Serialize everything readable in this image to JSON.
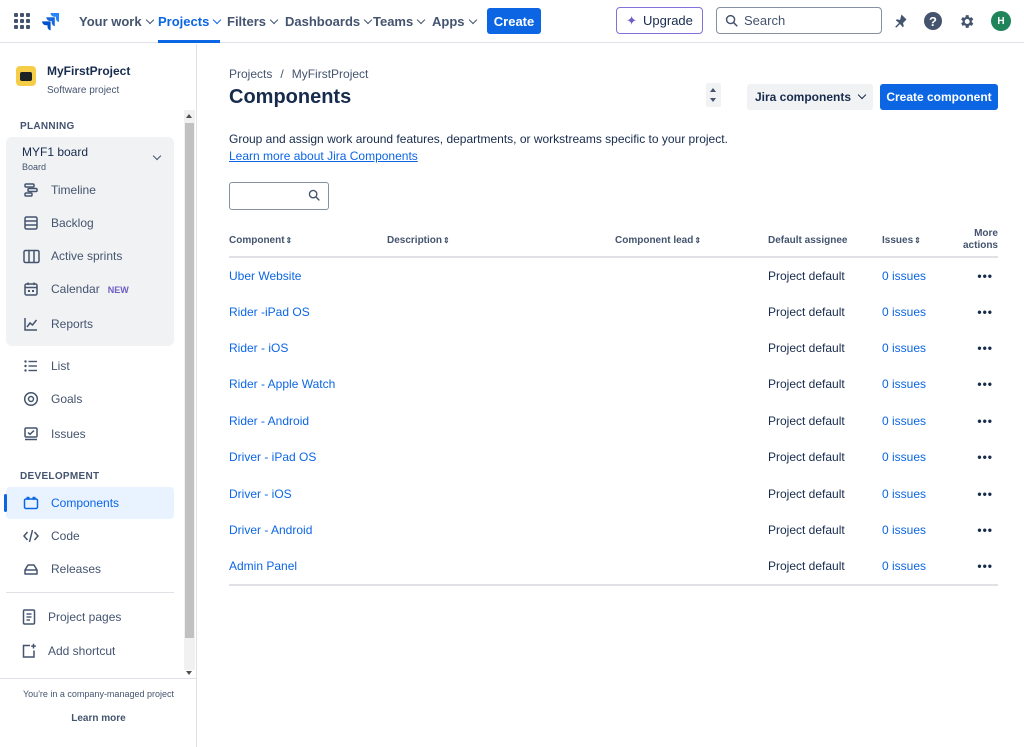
{
  "topnav": {
    "your_work": "Your work",
    "projects": "Projects",
    "filters": "Filters",
    "dashboards": "Dashboards",
    "teams": "Teams",
    "apps": "Apps",
    "create": "Create",
    "upgrade": "Upgrade",
    "search_placeholder": "Search",
    "avatar_initial": "H",
    "help_glyph": "?"
  },
  "project": {
    "name": "MyFirstProject",
    "type": "Software project"
  },
  "sidebar": {
    "planning_label": "PLANNING",
    "board": {
      "title": "MYF1 board",
      "subtitle": "Board"
    },
    "board_items": [
      {
        "label": "Timeline",
        "icon": "timeline-icon"
      },
      {
        "label": "Backlog",
        "icon": "backlog-icon"
      },
      {
        "label": "Active sprints",
        "icon": "board-icon"
      },
      {
        "label": "Calendar",
        "icon": "calendar-icon",
        "badge": "NEW"
      },
      {
        "label": "Reports",
        "icon": "reports-icon"
      }
    ],
    "items": [
      {
        "label": "List",
        "icon": "list-icon"
      },
      {
        "label": "Goals",
        "icon": "goals-icon"
      },
      {
        "label": "Issues",
        "icon": "issues-icon"
      }
    ],
    "development_label": "DEVELOPMENT",
    "dev_items": [
      {
        "label": "Components",
        "icon": "components-icon",
        "active": true
      },
      {
        "label": "Code",
        "icon": "code-icon"
      },
      {
        "label": "Releases",
        "icon": "releases-icon"
      }
    ],
    "bottom_items": [
      {
        "label": "Project pages",
        "icon": "project-pages-icon"
      },
      {
        "label": "Add shortcut",
        "icon": "add-shortcut-icon"
      }
    ],
    "footer_note": "You're in a company-managed project",
    "footer_link": "Learn more"
  },
  "main": {
    "breadcrumb": [
      "Projects",
      "MyFirstProject"
    ],
    "breadcrumb_separator": "/",
    "title": "Components",
    "jira_components_button": "Jira components",
    "create_component_button": "Create component",
    "description": "Group and assign work around features, departments, or workstreams specific to your project.",
    "learn_more": "Learn more about Jira Components",
    "filter_value": ""
  },
  "table": {
    "headers": {
      "component": "Component",
      "description": "Description",
      "lead": "Component lead",
      "assignee": "Default assignee",
      "issues": "Issues",
      "more_line1": "More",
      "more_line2": "actions"
    },
    "sort_glyph": "⇕",
    "rows": [
      {
        "component": "Uber Website",
        "description": "",
        "lead": "",
        "assignee": "Project default",
        "issues": "0 issues"
      },
      {
        "component": "Rider -iPad OS",
        "description": "",
        "lead": "",
        "assignee": "Project default",
        "issues": "0 issues"
      },
      {
        "component": "Rider - iOS",
        "description": "",
        "lead": "",
        "assignee": "Project default",
        "issues": "0 issues"
      },
      {
        "component": "Rider - Apple Watch",
        "description": "",
        "lead": "",
        "assignee": "Project default",
        "issues": "0 issues"
      },
      {
        "component": "Rider - Android",
        "description": "",
        "lead": "",
        "assignee": "Project default",
        "issues": "0 issues"
      },
      {
        "component": "Driver - iPad OS",
        "description": "",
        "lead": "",
        "assignee": "Project default",
        "issues": "0 issues"
      },
      {
        "component": "Driver - iOS",
        "description": "",
        "lead": "",
        "assignee": "Project default",
        "issues": "0 issues"
      },
      {
        "component": "Driver - Android",
        "description": "",
        "lead": "",
        "assignee": "Project default",
        "issues": "0 issues"
      },
      {
        "component": "Admin Panel",
        "description": "",
        "lead": "",
        "assignee": "Project default",
        "issues": "0 issues"
      }
    ],
    "row_actions_glyph": "•••"
  },
  "colors": {
    "brand_blue": "#0c66e4",
    "text": "#172b4d",
    "subtle_text": "#44546f",
    "board_group_bg": "#f1f2f4",
    "active_item_bg": "#e9f2ff",
    "avatar_bg": "#1f845a",
    "upgrade_border": "#8270db"
  }
}
